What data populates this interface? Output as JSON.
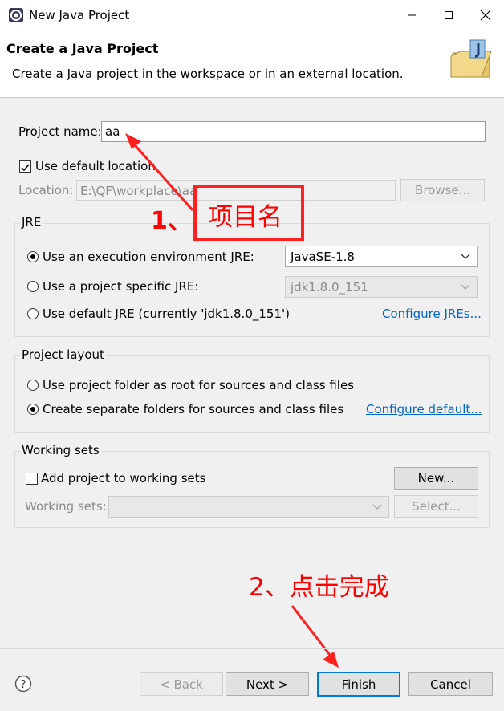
{
  "window": {
    "title": "New Java Project",
    "controls": [
      "minimize-icon",
      "maximize-icon",
      "close-icon"
    ]
  },
  "header": {
    "title": "Create a Java Project",
    "subtitle": "Create a Java project in the workspace or in an external location."
  },
  "project": {
    "name_label": "Project name:",
    "name_value": "aa",
    "use_default_label": "Use default location",
    "use_default_checked": true,
    "location_label": "Location:",
    "location_value": "E:\\QF\\workplace\\aa",
    "browse_label": "Browse..."
  },
  "jre": {
    "group_title": "JRE",
    "options": [
      {
        "label": "Use an execution environment JRE:",
        "selected": true
      },
      {
        "label": "Use a project specific JRE:",
        "selected": false
      },
      {
        "label": "Use default JRE (currently 'jdk1.8.0_151')",
        "selected": false
      }
    ],
    "env_combo_value": "JavaSE-1.8",
    "specific_combo_value": "jdk1.8.0_151",
    "configure_link": "Configure JREs..."
  },
  "layout": {
    "group_title": "Project layout",
    "options": [
      {
        "label": "Use project folder as root for sources and class files",
        "selected": false
      },
      {
        "label": "Create separate folders for sources and class files",
        "selected": true
      }
    ],
    "configure_link": "Configure default..."
  },
  "working_sets": {
    "group_title": "Working sets",
    "add_label": "Add project to working sets",
    "add_checked": false,
    "new_label": "New...",
    "sets_label": "Working sets:",
    "select_label": "Select..."
  },
  "annotations": {
    "step1_number": "1、",
    "step1_text": "项目名",
    "step2_text": "2、点击完成",
    "color": "#ff2020"
  },
  "footer": {
    "help_icon": "help-icon",
    "back_label": "< Back",
    "next_label": "Next >",
    "finish_label": "Finish",
    "cancel_label": "Cancel"
  }
}
